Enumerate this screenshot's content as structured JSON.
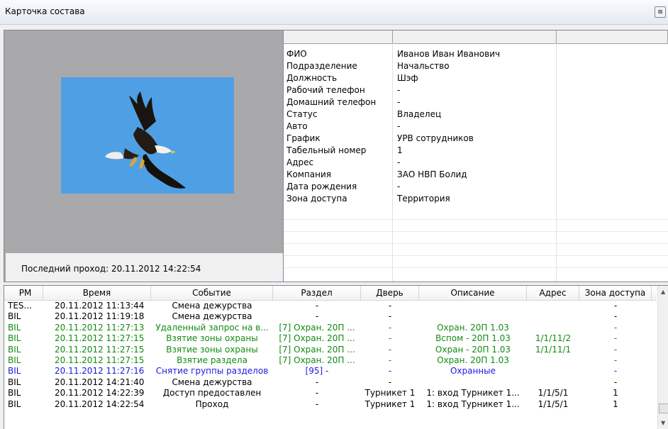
{
  "window": {
    "title": "Карточка состава",
    "close_glyph": "⊠"
  },
  "photo": {
    "alt": "eagle-photo",
    "bg_color": "#4f9fe4"
  },
  "last_pass": {
    "text": "Последний проход:  20.11.2012 14:22:54"
  },
  "info": {
    "rows": [
      {
        "label": "ФИО",
        "value": "Иванов Иван Иванович"
      },
      {
        "label": "Подразделение",
        "value": "Начальство"
      },
      {
        "label": "Должность",
        "value": "Шэф"
      },
      {
        "label": "Рабочий телефон",
        "value": "-"
      },
      {
        "label": "Домашний телефон",
        "value": "-"
      },
      {
        "label": "Статус",
        "value": "Владелец"
      },
      {
        "label": "Авто",
        "value": "-"
      },
      {
        "label": "График",
        "value": "УРВ сотрудников"
      },
      {
        "label": "Табельный номер",
        "value": "1"
      },
      {
        "label": "Адрес",
        "value": "-"
      },
      {
        "label": "Компания",
        "value": "ЗАО НВП Болид"
      },
      {
        "label": "Дата рождения",
        "value": "-"
      },
      {
        "label": "Зона доступа",
        "value": "Территория"
      }
    ]
  },
  "events": {
    "columns": [
      "РМ",
      "Время",
      "Событие",
      "Раздел",
      "Дверь",
      "Описание",
      "Адрес",
      "Зона доступа"
    ],
    "rows": [
      {
        "color": "#000000",
        "cells": [
          "TES...",
          "20.11.2012 11:13:44",
          "Смена дежурства",
          "-",
          "-",
          "",
          "",
          "-"
        ]
      },
      {
        "color": "#000000",
        "cells": [
          "BIL",
          "20.11.2012 11:19:18",
          "Смена дежурства",
          "-",
          "-",
          "",
          "",
          "-"
        ]
      },
      {
        "color": "#118c11",
        "cells": [
          "BIL",
          "20.11.2012 11:27:13",
          "Удаленный запрос на в...",
          "[7] Охран. 20П ...",
          "-",
          "Охран. 20П 1.03",
          "",
          "-"
        ]
      },
      {
        "color": "#118c11",
        "cells": [
          "BIL",
          "20.11.2012 11:27:15",
          "Взятие зоны охраны",
          "[7] Охран. 20П ...",
          "-",
          "Вспом - 20П 1.03",
          "1/1/11/2",
          "-"
        ]
      },
      {
        "color": "#118c11",
        "cells": [
          "BIL",
          "20.11.2012 11:27:15",
          "Взятие зоны охраны",
          "[7] Охран. 20П ...",
          "-",
          "Охран - 20П 1.03",
          "1/1/11/1",
          "-"
        ]
      },
      {
        "color": "#118c11",
        "cells": [
          "BIL",
          "20.11.2012 11:27:15",
          "Взятие раздела",
          "[7] Охран. 20П ...",
          "-",
          "Охран. 20П 1.03",
          "",
          "-"
        ]
      },
      {
        "color": "#1a1ae0",
        "cells": [
          "BIL",
          "20.11.2012 11:27:16",
          "Снятие группы разделов",
          "[95] -",
          "-",
          "Охранные",
          "",
          "-"
        ]
      },
      {
        "color": "#000000",
        "cells": [
          "BIL",
          "20.11.2012 14:21:40",
          "Смена дежурства",
          "-",
          "-",
          "",
          "",
          "-"
        ]
      },
      {
        "color": "#000000",
        "cells": [
          "BIL",
          "20.11.2012 14:22:39",
          "Доступ предоставлен",
          "-",
          "Турникет 1",
          "1: вход  Турникет 1...",
          "1/1/5/1",
          "1"
        ]
      },
      {
        "color": "#000000",
        "cells": [
          "BIL",
          "20.11.2012 14:22:54",
          "Проход",
          "-",
          "Турникет 1",
          "1: вход  Турникет 1...",
          "1/1/5/1",
          "1"
        ]
      }
    ]
  },
  "scrollbar": {
    "up": "▲",
    "down": "▼"
  }
}
